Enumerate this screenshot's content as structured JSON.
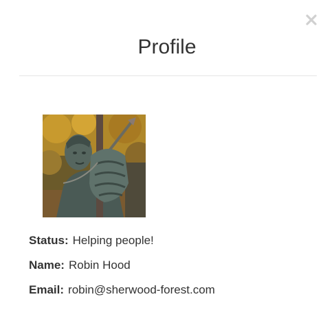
{
  "modal": {
    "title": "Profile",
    "close_icon": "close-icon"
  },
  "profile": {
    "avatar_icon": "avatar-image",
    "status_label": "Status:",
    "status_value": "Helping people!",
    "name_label": "Name:",
    "name_value": "Robin Hood",
    "email_label": "Email:",
    "email_value": "robin@sherwood-forest.com"
  },
  "colors": {
    "text": "#333333",
    "divider": "#e5e5e5",
    "close": "#cccccc"
  }
}
